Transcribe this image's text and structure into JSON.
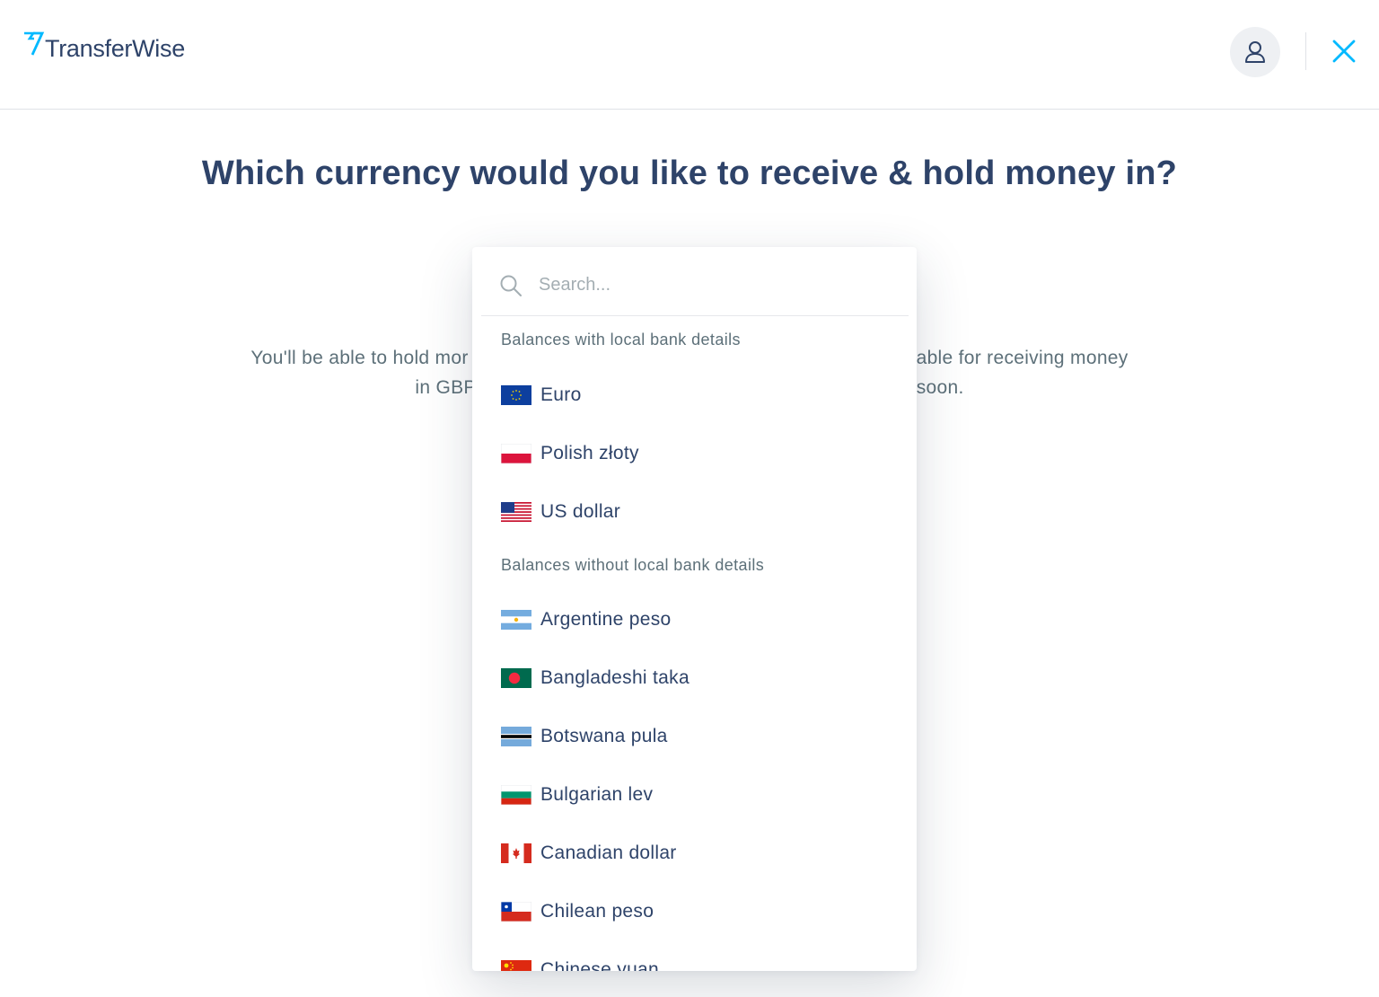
{
  "brand": {
    "name": "TransferWise",
    "accent": "#00b9ff",
    "text_color": "#2e4369"
  },
  "header": {
    "avatar_icon": "user-icon",
    "close_icon": "close-icon"
  },
  "title": "Which currency would you like to receive & hold money in?",
  "background_text": {
    "line1_left": "You'll be able to hold mor",
    "line1_right": "lable for receiving money",
    "line2_left": "in GBP",
    "line2_right": "soon."
  },
  "dropdown": {
    "search_placeholder": "Search...",
    "sections": [
      {
        "title": "Balances with local bank details",
        "items": [
          {
            "label": "Euro",
            "flag": "eu"
          },
          {
            "label": "Polish złoty",
            "flag": "pl"
          },
          {
            "label": "US dollar",
            "flag": "us"
          }
        ]
      },
      {
        "title": "Balances without local bank details",
        "items": [
          {
            "label": "Argentine peso",
            "flag": "ar"
          },
          {
            "label": "Bangladeshi taka",
            "flag": "bd"
          },
          {
            "label": "Botswana pula",
            "flag": "bw"
          },
          {
            "label": "Bulgarian lev",
            "flag": "bg"
          },
          {
            "label": "Canadian dollar",
            "flag": "ca"
          },
          {
            "label": "Chilean peso",
            "flag": "cl"
          },
          {
            "label": "Chinese yuan",
            "flag": "cn"
          }
        ]
      }
    ]
  }
}
